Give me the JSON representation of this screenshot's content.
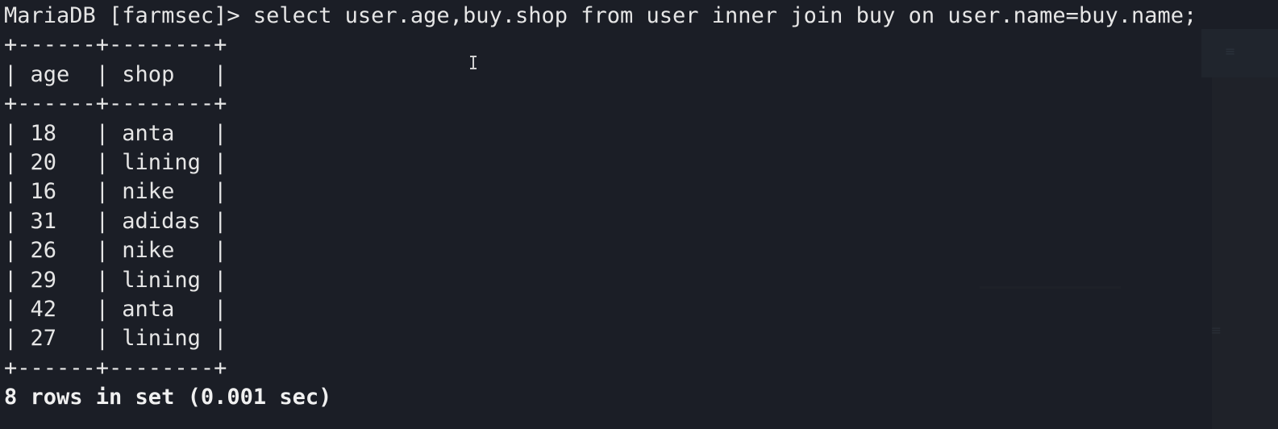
{
  "terminal": {
    "command_line": "MariaDB [farmsec]> select user.age,buy.shop from user inner join buy on user.name=buy.name;",
    "table_border": "+------+--------+",
    "header_row": "| age  | shop   |",
    "rows": [
      "| 18   | anta   |",
      "| 20   | lining |",
      "| 16   | nike   |",
      "| 31   | adidas |",
      "| 26   | nike   |",
      "| 29   | lining |",
      "| 42   | anta   |",
      "| 27   | lining |"
    ],
    "summary": "8 rows in set (0.001 sec)"
  },
  "icons": {
    "cursor": "text-cursor-icon"
  }
}
